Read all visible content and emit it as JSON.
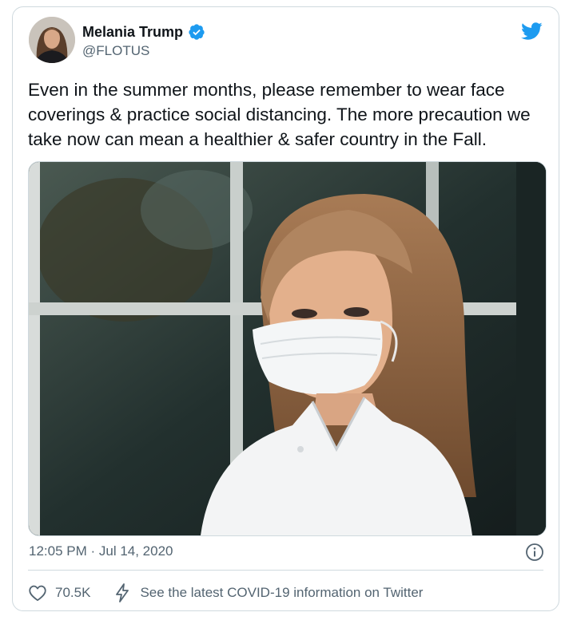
{
  "author": {
    "display_name": "Melania Trump",
    "handle": "@FLOTUS",
    "verified": true
  },
  "tweet": {
    "text": "Even in the summer months, please remember to wear face coverings & practice social distancing. The more precaution we take now can mean a healthier & safer country in the Fall.",
    "timestamp": "12:05 PM · Jul 14, 2020"
  },
  "actions": {
    "like_count": "70.5K",
    "covid_info": "See the latest COVID-19 information on Twitter"
  },
  "icons": {
    "brand": "twitter-bird-icon",
    "verified": "verified-badge-icon",
    "info": "info-icon",
    "like": "heart-icon",
    "covid": "lightning-icon"
  },
  "colors": {
    "brand": "#1d9bf0",
    "text_primary": "#0f1419",
    "text_secondary": "#536471",
    "border": "#cfd9de"
  }
}
